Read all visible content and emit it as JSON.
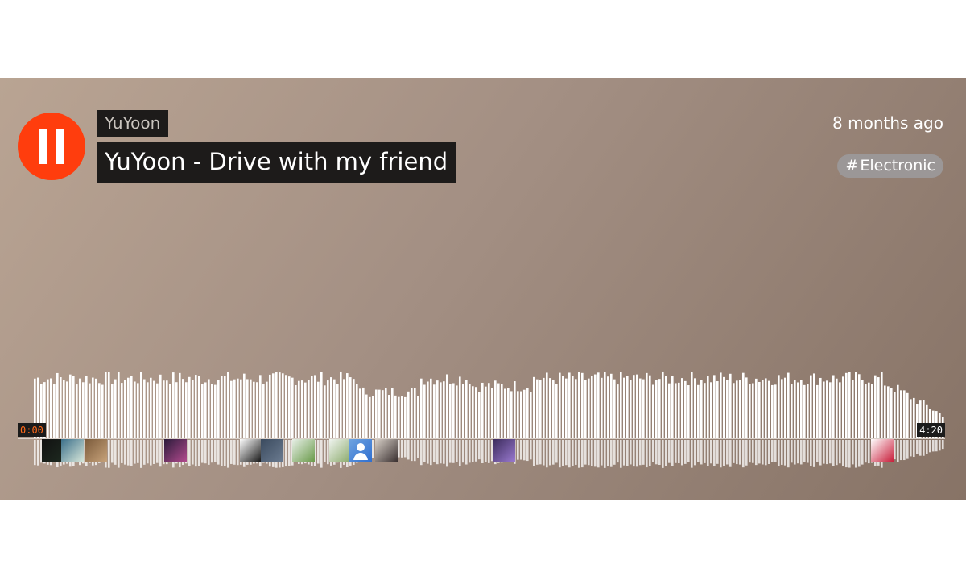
{
  "track": {
    "artist": "YuYoon",
    "title": "YuYoon - Drive with my friend",
    "posted": "8 months ago",
    "tag_symbol": "#",
    "tag": "Electronic"
  },
  "player": {
    "state": "playing",
    "control_icon": "pause-icon",
    "current_time": "0:00",
    "duration": "4:20",
    "progress": 0.0
  },
  "colors": {
    "accent": "#ff3d0d",
    "label_bg": "#1d1b1a",
    "wave": "#ffffff",
    "played": "#ff6a1a"
  },
  "comments": [
    {
      "at_fraction": 0.026,
      "icon": "avatar-icon",
      "colors": [
        "#111111",
        "#1e2a20"
      ]
    },
    {
      "at_fraction": 0.047,
      "icon": "avatar-icon",
      "colors": [
        "#3b6f8a",
        "#d6e6d9"
      ]
    },
    {
      "at_fraction": 0.072,
      "icon": "avatar-icon",
      "colors": [
        "#7a5a3a",
        "#c7a27a"
      ]
    },
    {
      "at_fraction": 0.158,
      "icon": "avatar-icon",
      "colors": [
        "#2a1b3a",
        "#b24a8e"
      ]
    },
    {
      "at_fraction": 0.24,
      "icon": "avatar-icon",
      "colors": [
        "#ffffff",
        "#111111"
      ]
    },
    {
      "at_fraction": 0.262,
      "icon": "avatar-icon",
      "colors": [
        "#3a4a5e",
        "#6b7b90"
      ]
    },
    {
      "at_fraction": 0.296,
      "icon": "avatar-icon",
      "colors": [
        "#e8f0e8",
        "#6a9a4a"
      ]
    },
    {
      "at_fraction": 0.336,
      "icon": "avatar-icon",
      "colors": [
        "#f0f4f0",
        "#88a868"
      ]
    },
    {
      "at_fraction": 0.358,
      "icon": "default-avatar-icon",
      "colors": [
        "#6fa3e0",
        "#2f6fd0"
      ]
    },
    {
      "at_fraction": 0.385,
      "icon": "avatar-icon",
      "colors": [
        "#d8d0c8",
        "#3a3030"
      ]
    },
    {
      "at_fraction": 0.512,
      "icon": "avatar-icon",
      "colors": [
        "#3a2a5a",
        "#9a7ad0"
      ]
    },
    {
      "at_fraction": 0.92,
      "icon": "avatar-icon",
      "colors": [
        "#ffffff",
        "#c81e3a"
      ]
    }
  ]
}
